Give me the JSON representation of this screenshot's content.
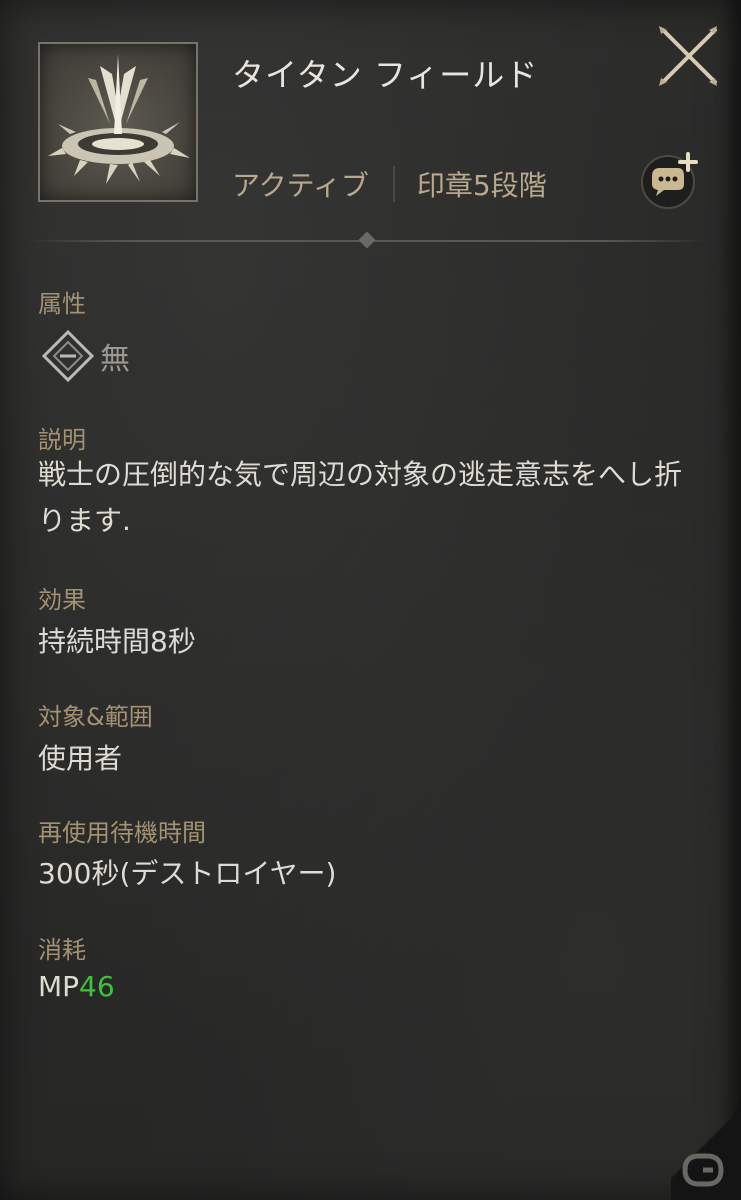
{
  "skill": {
    "name": "タイタン フィールド",
    "icon": "titan-field-skill-icon",
    "type_tag": "アクティブ",
    "seal_tag": "印章5段階"
  },
  "controls": {
    "close_icon": "close-x-icon",
    "chat_share_icon": "chat-plus-icon"
  },
  "attribute": {
    "label": "属性",
    "value": "無",
    "icon": "diamond-element-icon"
  },
  "description": {
    "label": "説明",
    "text": "戦士の圧倒的な気で周辺の対象の逃走意志をへし折ります."
  },
  "effect": {
    "label": "効果",
    "value": "持続時間8秒"
  },
  "target": {
    "label": "対象&範囲",
    "value": "使用者"
  },
  "cooldown": {
    "label": "再使用待機時間",
    "value": "300秒(デストロイヤー)"
  },
  "cost": {
    "label": "消耗",
    "prefix": "MP",
    "amount": "46"
  },
  "colors": {
    "label_gold": "#a39272",
    "tag_gold": "#b8a88c",
    "value_text": "#dedbd3",
    "mp_green": "#3ec23a",
    "panel_bg": "#2a2a29"
  }
}
